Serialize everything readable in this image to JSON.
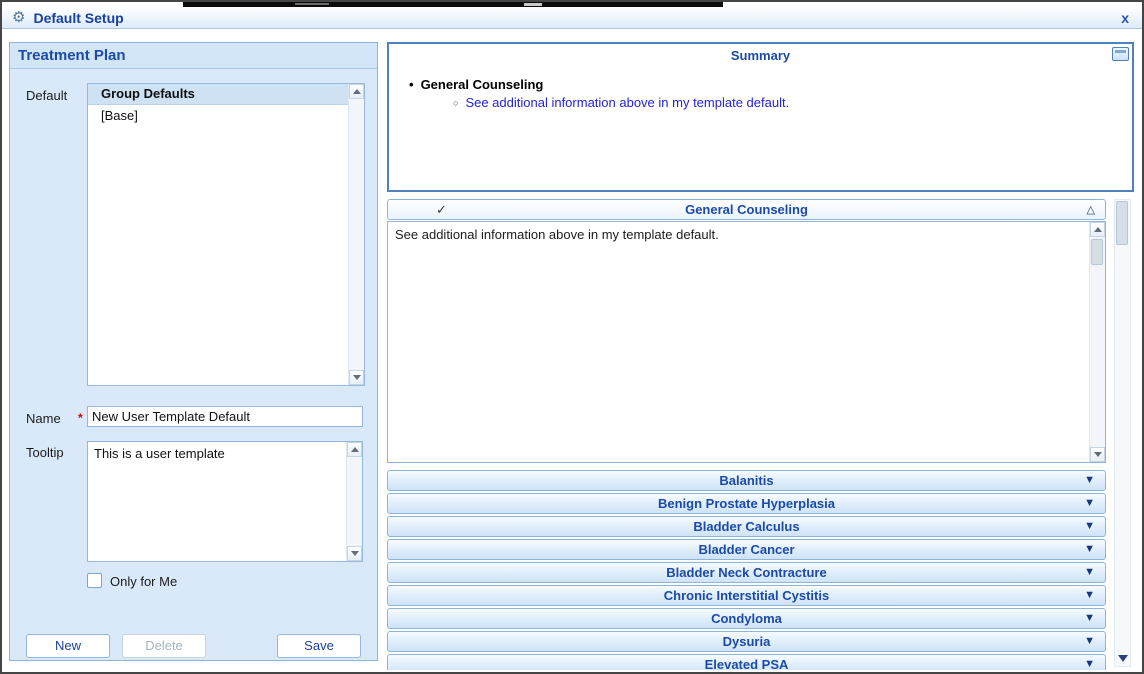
{
  "titlebar": {
    "gear_glyph": "⚙",
    "title": "Default Setup",
    "close_label": "x"
  },
  "left": {
    "header": "Treatment Plan",
    "default_label": "Default",
    "listbox": {
      "header": "Group Defaults",
      "items": [
        "[Base]"
      ]
    },
    "name_label": "Name",
    "required_mark": "*",
    "name_value": "New User Template Default",
    "tooltip_label": "Tooltip",
    "tooltip_value": "This is a user template",
    "only_for_me": "Only for Me",
    "new_button": "New",
    "delete_button": "Delete",
    "save_button": "Save"
  },
  "right": {
    "summary": {
      "title": "Summary",
      "bullet_glyph": "•",
      "sub_bullet_glyph": "○",
      "bullet_heading": "General Counseling",
      "bullet_link": "See additional information above in my template default."
    },
    "expanded": {
      "check": "✓",
      "title": "General Counseling",
      "collapse_glyph": "△",
      "content": "See additional information above in my template default."
    },
    "expand_glyph": "▼",
    "sections": [
      "Balanitis",
      "Benign Prostate Hyperplasia",
      "Bladder Calculus",
      "Bladder Cancer",
      "Bladder Neck Contracture",
      "Chronic Interstitial Cystitis",
      "Condyloma",
      "Dysuria",
      "Elevated PSA"
    ]
  },
  "colors": {
    "accent_blue": "#1c4aa8",
    "border_blue": "#8fb4da",
    "panel_blue": "#d9e9f9",
    "summary_border": "#4f81bd",
    "link_blue": "#2424d4"
  }
}
